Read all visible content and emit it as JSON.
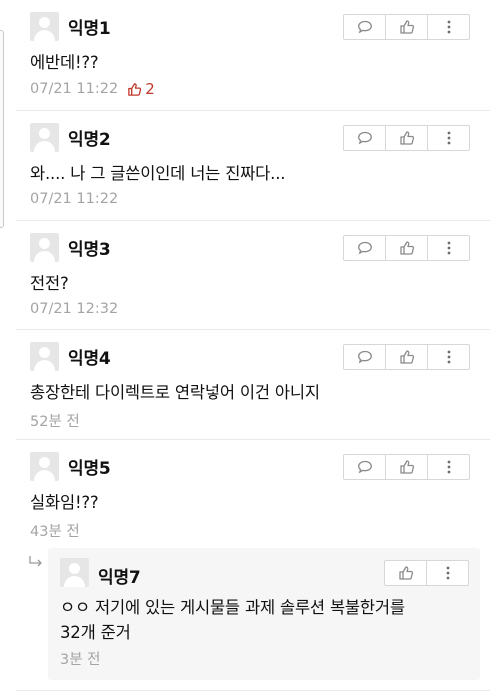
{
  "comments": [
    {
      "author": "익명1",
      "text": "에반데!??",
      "time": "07/21 11:22",
      "likes": "2"
    },
    {
      "author": "익명2",
      "text": "와.... 나 그 글쓴이인데 너는 진짜다...",
      "time": "07/21 11:22"
    },
    {
      "author": "익명3",
      "text": "전전?",
      "time": "07/21 12:32"
    },
    {
      "author": "익명4",
      "text": "총장한테 다이렉트로 연락넣어 이건 아니지",
      "time": "52분 전"
    },
    {
      "author": "익명5",
      "text": "실화임!??",
      "time": "43분 전"
    }
  ],
  "reply": {
    "author": "익명7",
    "text_line1": "ㅇㅇ 저기에 있는 게시물들 과제 솔루션 복불한거를",
    "text_line2": "32개 준거",
    "time": "3분 전"
  },
  "icons": {
    "reply": "speech-bubble-icon",
    "like": "thumbs-up-icon",
    "more": "more-vertical-icon",
    "reply_indicator": "reply-arrow-icon"
  },
  "colors": {
    "like_count": "#c0392b",
    "meta": "#a4a4a4",
    "reply_bg": "#f6f6f6"
  }
}
